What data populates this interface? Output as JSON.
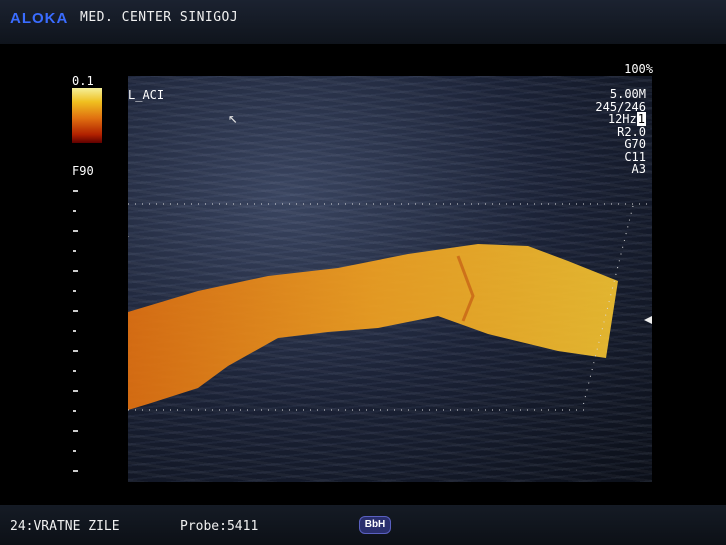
{
  "header": {
    "brand": "ALOKA",
    "center": "MED. CENTER SINIGOJ"
  },
  "image_panel": {
    "zoom": "100%",
    "vessel_label": "L_ACI",
    "scale_top": "0.1",
    "filter": "F90"
  },
  "params": {
    "freq": "5.00M",
    "frame": "245/246",
    "rate": "12Hz",
    "rate_badge": "1",
    "r": "R2.0",
    "g": "G70",
    "c": "C11",
    "a": "A3"
  },
  "footer": {
    "preset": "24:VRATNE ZILE",
    "probe": "Probe:5411",
    "badge": "BbH"
  },
  "colors": {
    "brand": "#3a6cff",
    "flow_hot": "#f0b020",
    "flow_mid": "#e07010"
  }
}
